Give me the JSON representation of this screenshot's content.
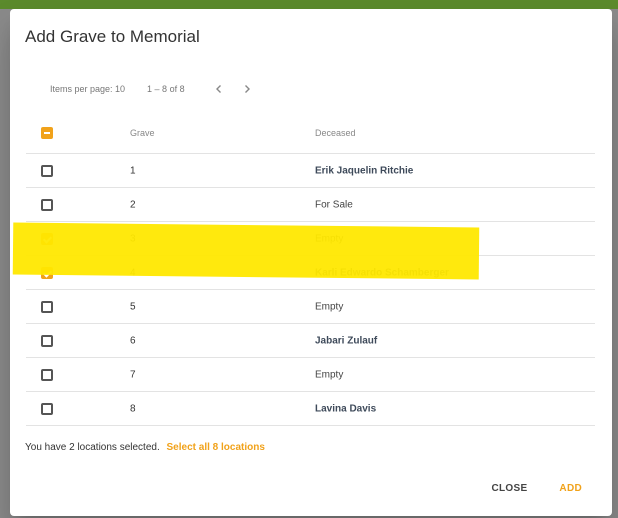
{
  "dialog": {
    "title": "Add Grave to Memorial"
  },
  "paginator": {
    "items_per_page": "Items per page: 10",
    "range": "1 – 8 of 8",
    "prev_icon": "chevron-left-icon",
    "next_icon": "chevron-right-icon"
  },
  "table": {
    "headers": {
      "grave": "Grave",
      "deceased": "Deceased"
    },
    "rows": [
      {
        "grave": "1",
        "deceased": "Erik Jaquelin Ritchie",
        "named": true,
        "checked": false
      },
      {
        "grave": "2",
        "deceased": "For Sale",
        "named": false,
        "checked": false
      },
      {
        "grave": "3",
        "deceased": "Empty",
        "named": false,
        "checked": true
      },
      {
        "grave": "4",
        "deceased": "Karli Edwardo Schamberger",
        "named": true,
        "checked": true
      },
      {
        "grave": "5",
        "deceased": "Empty",
        "named": false,
        "checked": false
      },
      {
        "grave": "6",
        "deceased": "Jabari Zulauf",
        "named": true,
        "checked": false
      },
      {
        "grave": "7",
        "deceased": "Empty",
        "named": false,
        "checked": false
      },
      {
        "grave": "8",
        "deceased": "Lavina Davis",
        "named": true,
        "checked": false
      }
    ]
  },
  "status": {
    "selected_text": "You have 2 locations selected.",
    "select_all_link": "Select all 8 locations"
  },
  "actions": {
    "close_label": "CLOSE",
    "add_label": "ADD"
  },
  "colors": {
    "accent": "#f1a21a",
    "highlight": "#ffe800",
    "topbar": "#5b8a2c"
  }
}
